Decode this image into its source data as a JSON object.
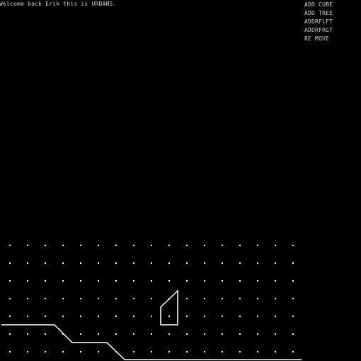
{
  "header": {
    "welcome_text": "Welcome back Erik this is URBAN5."
  },
  "menu": {
    "items": [
      {
        "label": "ADD CUBE",
        "name": "add-cube-button"
      },
      {
        "label": "ADD TREE",
        "name": "add-tree-button"
      },
      {
        "label": "ADDRFLFT",
        "name": "add-roof-left-button"
      },
      {
        "label": "ADDRFRGT",
        "name": "add-roof-right-button"
      },
      {
        "label": "RE MOVE",
        "name": "remove-button"
      }
    ]
  },
  "colors": {
    "background": "#000000",
    "text": "#cfcfcf",
    "lines": "#ffffff",
    "grid_dots": "#ffffff"
  }
}
